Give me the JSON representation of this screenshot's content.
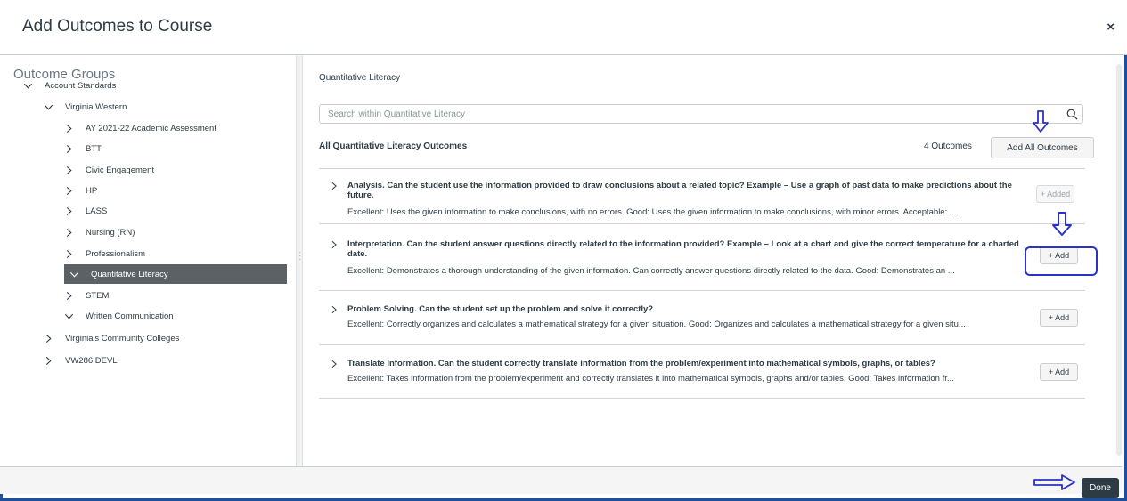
{
  "modal": {
    "title": "Add Outcomes to Course",
    "close_label": "×",
    "done_label": "Done"
  },
  "sidebar": {
    "heading": "Outcome Groups",
    "items": [
      {
        "label": "Account Standards",
        "level": 0,
        "expanded": true,
        "selected": false
      },
      {
        "label": "Virginia Western",
        "level": 1,
        "expanded": true,
        "selected": false
      },
      {
        "label": "AY 2021-22 Academic Assessment",
        "level": 2,
        "expanded": false,
        "selected": false
      },
      {
        "label": "BTT",
        "level": 2,
        "expanded": false,
        "selected": false
      },
      {
        "label": "Civic Engagement",
        "level": 2,
        "expanded": false,
        "selected": false
      },
      {
        "label": "HP",
        "level": 2,
        "expanded": false,
        "selected": false
      },
      {
        "label": "LASS",
        "level": 2,
        "expanded": false,
        "selected": false
      },
      {
        "label": "Nursing (RN)",
        "level": 2,
        "expanded": false,
        "selected": false
      },
      {
        "label": "Professionalism",
        "level": 2,
        "expanded": false,
        "selected": false
      },
      {
        "label": "Quantitative Literacy",
        "level": 2,
        "expanded": true,
        "selected": true
      },
      {
        "label": "STEM",
        "level": 2,
        "expanded": false,
        "selected": false
      },
      {
        "label": "Written Communication",
        "level": 2,
        "expanded": true,
        "selected": false
      },
      {
        "label": "Virginia's Community Colleges",
        "level": 1,
        "expanded": false,
        "selected": false
      },
      {
        "label": "VW286 DEVL",
        "level": 1,
        "expanded": false,
        "selected": false
      }
    ]
  },
  "main": {
    "group_title": "Quantitative Literacy",
    "search_placeholder": "Search within Quantitative Literacy",
    "all_label": "All Quantitative Literacy Outcomes",
    "count_label": "4 Outcomes",
    "add_all_label": "Add All Outcomes",
    "outcomes": [
      {
        "title": "Analysis. Can the student use the information provided to draw conclusions about a related topic? Example – Use a graph of past data to make predictions about the future.",
        "description": "Excellent: Uses the given information to make conclusions, with no errors. Good: Uses the given information to make conclusions, with minor errors. Acceptable: ...",
        "button_label": "+ Added",
        "added": true
      },
      {
        "title": "Interpretation. Can the student answer questions directly related to the information provided? Example – Look at a chart and give the correct temperature for a charted date.",
        "description": "Excellent: Demonstrates a thorough understanding of the given information. Can correctly answer questions directly related to the data. Good: Demonstrates an ...",
        "button_label": "+ Add",
        "added": false
      },
      {
        "title": "Problem Solving. Can the student set up the problem and solve it correctly?",
        "description": "Excellent: Correctly organizes and calculates a mathematical strategy for a given situation. Good: Organizes and calculates a mathematical strategy for a given situ...",
        "button_label": "+ Add",
        "added": false
      },
      {
        "title": "Translate Information. Can the student correctly translate information from the problem/experiment into mathematical symbols, graphs, or tables?",
        "description": "Excellent: Takes information from the problem/experiment and correctly translates it into mathematical symbols, graphs and/or tables. Good: Takes information fr...",
        "button_label": "+ Add",
        "added": false
      }
    ]
  },
  "colors": {
    "frame": "#1f4e9b",
    "annotation": "#2a32c7",
    "selected_bg": "#5c6166",
    "done_bg": "#2d3b45"
  }
}
